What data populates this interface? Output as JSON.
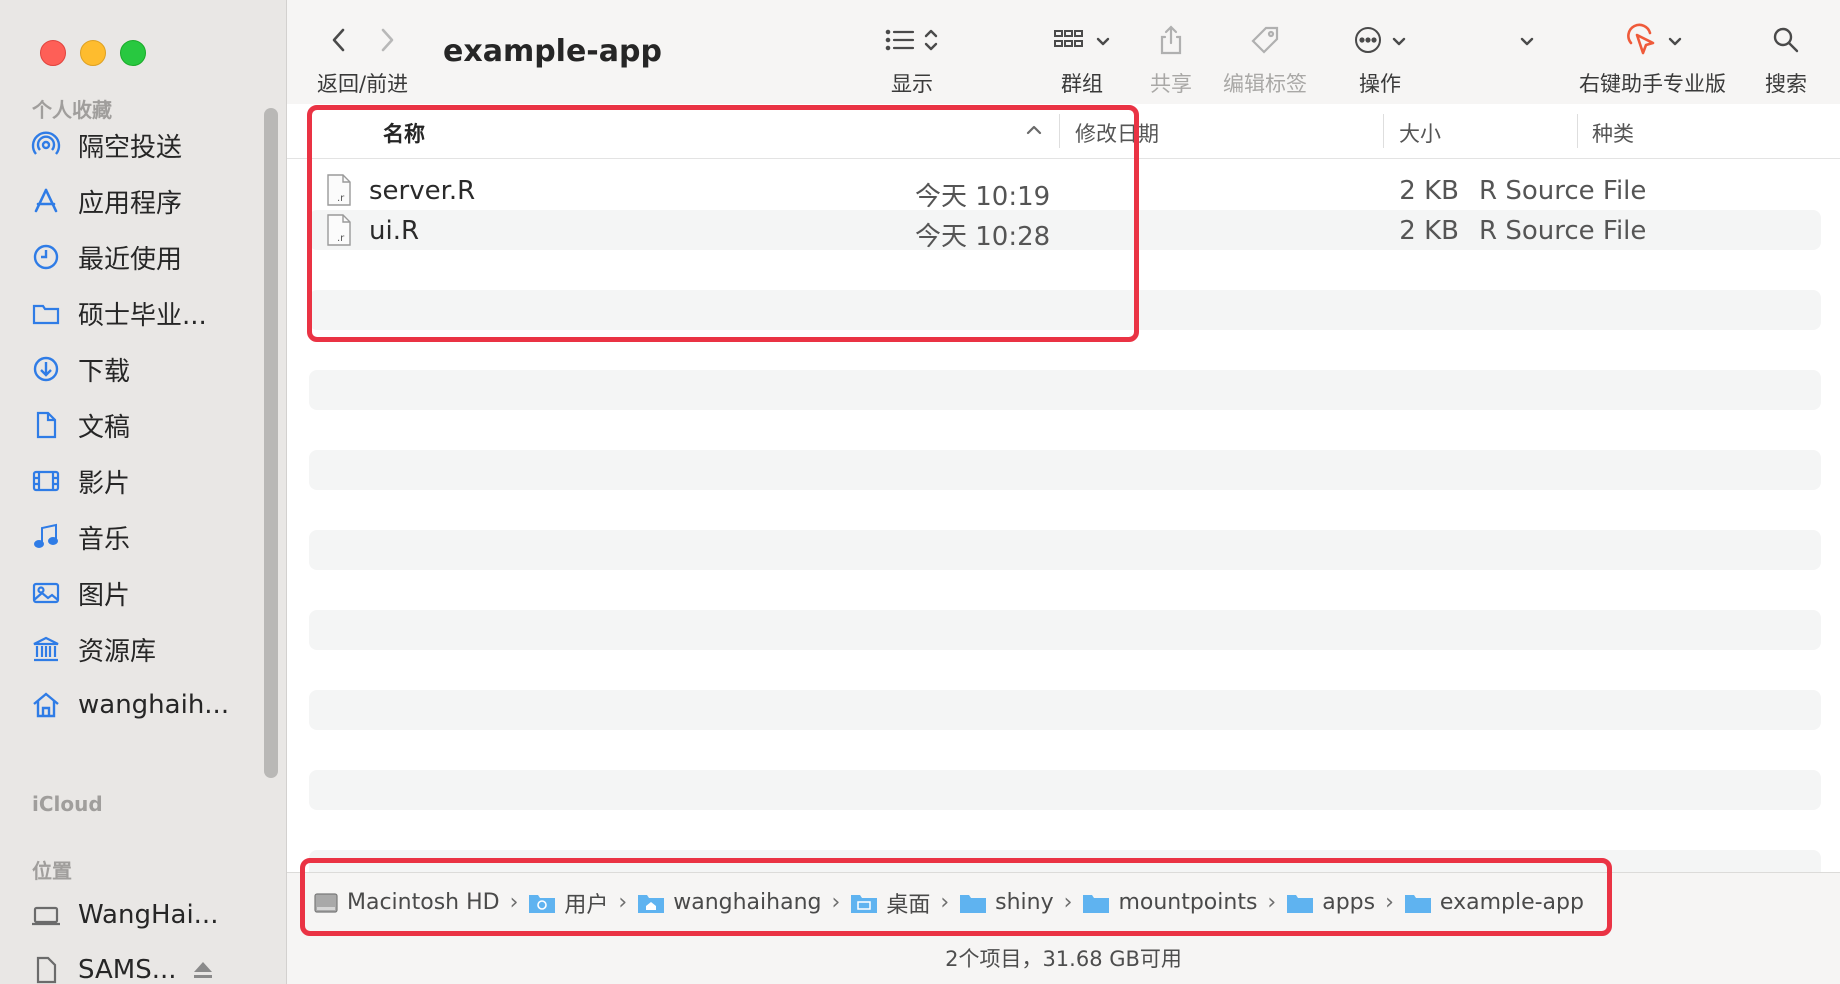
{
  "window": {
    "title": "example-app"
  },
  "sidebar": {
    "favorites_heading": "个人收藏",
    "items": [
      {
        "label": "隔空投送",
        "icon": "airdrop-icon"
      },
      {
        "label": "应用程序",
        "icon": "applications-icon"
      },
      {
        "label": "最近使用",
        "icon": "clock-icon"
      },
      {
        "label": "硕士毕业...",
        "icon": "folder-icon"
      },
      {
        "label": "下载",
        "icon": "download-icon"
      },
      {
        "label": "文稿",
        "icon": "document-icon"
      },
      {
        "label": "影片",
        "icon": "film-icon"
      },
      {
        "label": "音乐",
        "icon": "music-icon"
      },
      {
        "label": "图片",
        "icon": "photo-icon"
      },
      {
        "label": "资源库",
        "icon": "library-icon"
      },
      {
        "label": "wanghaih...",
        "icon": "home-icon"
      }
    ],
    "icloud_heading": "iCloud",
    "locations_heading": "位置",
    "locations": [
      {
        "label": "WangHai...",
        "icon": "laptop-icon"
      },
      {
        "label": "SAMS...",
        "icon": "drive-icon"
      }
    ]
  },
  "toolbar": {
    "back_forward_label": "返回/前进",
    "view_label": "显示",
    "group_label": "群组",
    "share_label": "共享",
    "tags_label": "编辑标签",
    "action_label": "操作",
    "rightclick_label": "右键助手专业版",
    "search_label": "搜索"
  },
  "columns": {
    "name": "名称",
    "date": "修改日期",
    "size": "大小",
    "kind": "种类"
  },
  "files": [
    {
      "name": "server.R",
      "date": "今天 10:19",
      "size": "2 KB",
      "kind": "R Source File"
    },
    {
      "name": "ui.R",
      "date": "今天 10:28",
      "size": "2 KB",
      "kind": "R Source File"
    }
  ],
  "path": [
    {
      "label": "Macintosh HD",
      "icon": "hard-disk-icon"
    },
    {
      "label": "用户",
      "icon": "users-folder-icon"
    },
    {
      "label": "wanghaihang",
      "icon": "home-folder-icon"
    },
    {
      "label": "桌面",
      "icon": "desktop-folder-icon"
    },
    {
      "label": "shiny",
      "icon": "folder-icon"
    },
    {
      "label": "mountpoints",
      "icon": "folder-icon"
    },
    {
      "label": "apps",
      "icon": "folder-icon"
    },
    {
      "label": "example-app",
      "icon": "folder-icon"
    }
  ],
  "status": "2个项目，31.68 GB可用",
  "colors": {
    "accent": "#2f7ce6",
    "annotation": "#ea3344",
    "rightclick_accent": "#ef5a3a"
  }
}
